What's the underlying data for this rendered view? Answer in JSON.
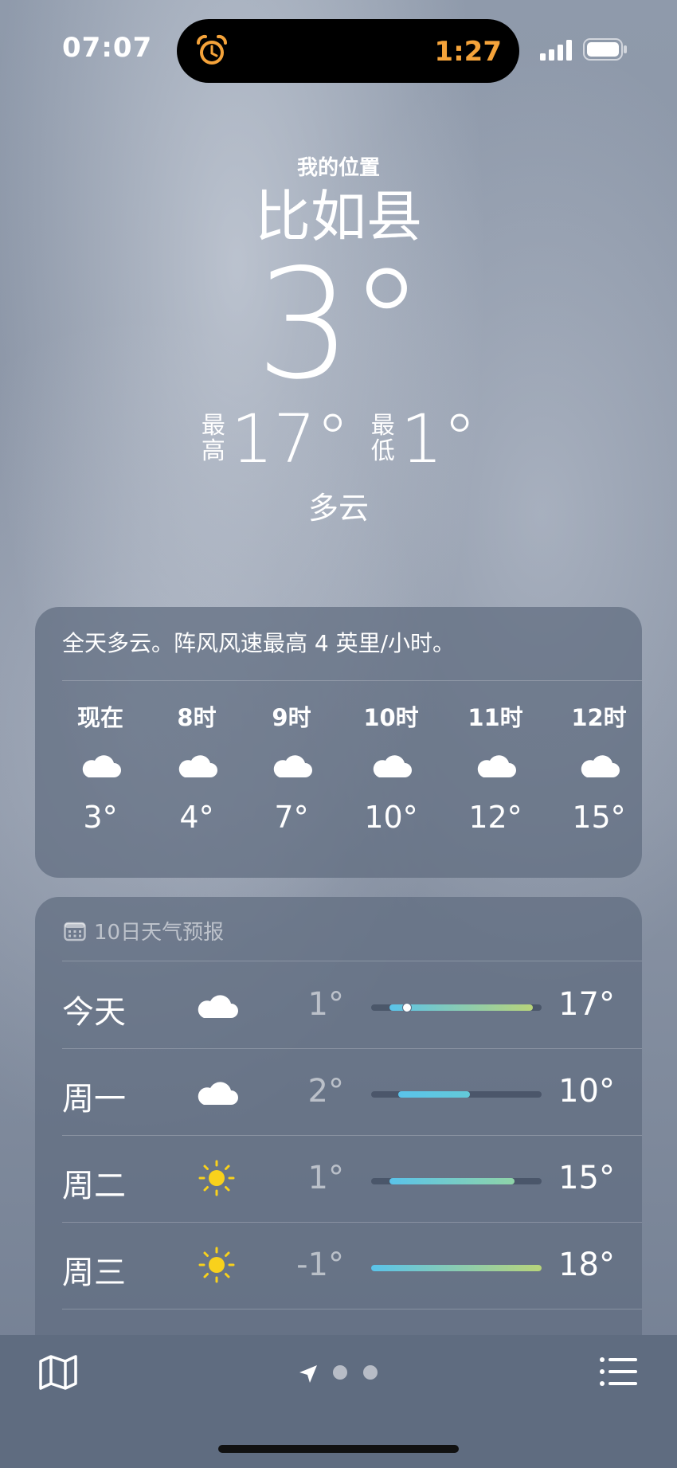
{
  "status": {
    "time": "07:07",
    "timer": "1:27",
    "alarm_icon": "alarm-clock-icon",
    "timer_color": "#f5a33a"
  },
  "hero": {
    "location_label": "我的位置",
    "city": "比如县",
    "temperature": "3°",
    "high_label": "最高",
    "high": "17°",
    "low_label": "最低",
    "low": "1°",
    "condition": "多云"
  },
  "hourly": {
    "summary": "全天多云。阵风风速最高 4 英里/小时。",
    "items": [
      {
        "hour": "现在",
        "icon": "cloud-icon",
        "temp": "3°"
      },
      {
        "hour": "8时",
        "icon": "cloud-icon",
        "temp": "4°"
      },
      {
        "hour": "9时",
        "icon": "cloud-icon",
        "temp": "7°"
      },
      {
        "hour": "10时",
        "icon": "cloud-icon",
        "temp": "10°"
      },
      {
        "hour": "11时",
        "icon": "cloud-icon",
        "temp": "12°"
      },
      {
        "hour": "12时",
        "icon": "cloud-icon",
        "temp": "15°"
      }
    ]
  },
  "forecast": {
    "title": "10日天气预报",
    "range_min": -1,
    "range_max": 18,
    "days": [
      {
        "day": "今天",
        "icon": "cloud-icon",
        "low": "1°",
        "high": "17°",
        "low_val": 1,
        "high_val": 17,
        "current_val": 3
      },
      {
        "day": "周一",
        "icon": "cloud-icon",
        "low": "2°",
        "high": "10°",
        "low_val": 2,
        "high_val": 10
      },
      {
        "day": "周二",
        "icon": "sun-icon",
        "low": "1°",
        "high": "15°",
        "low_val": 1,
        "high_val": 15
      },
      {
        "day": "周三",
        "icon": "sun-icon",
        "low": "-1°",
        "high": "18°",
        "low_val": -1,
        "high_val": 18
      }
    ]
  },
  "tabbar": {
    "page_count": 2
  }
}
